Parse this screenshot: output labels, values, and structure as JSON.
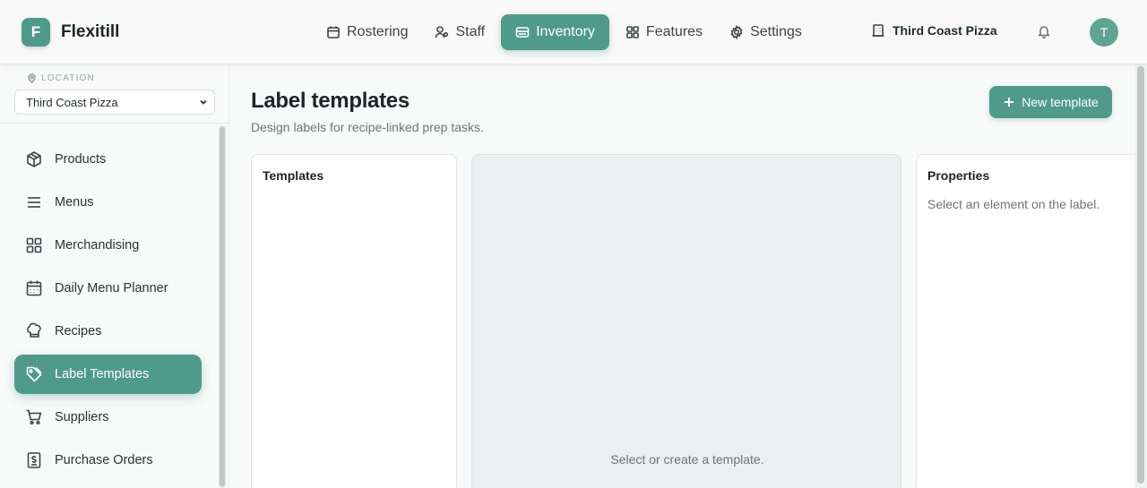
{
  "app": {
    "logo_letter": "F",
    "name": "Flexitill"
  },
  "nav": [
    {
      "label": "Rostering",
      "icon": "calendar-icon"
    },
    {
      "label": "Staff",
      "icon": "staff-icon"
    },
    {
      "label": "Inventory",
      "icon": "inventory-icon",
      "active": true
    },
    {
      "label": "Features",
      "icon": "grid-icon"
    },
    {
      "label": "Settings",
      "icon": "gear-icon"
    }
  ],
  "header": {
    "store_name": "Third Coast Pizza",
    "avatar_initial": "T"
  },
  "sidebar": {
    "location_label": "LOCATION",
    "location_value": "Third Coast Pizza",
    "items": [
      {
        "label": "Products",
        "icon": "box-icon"
      },
      {
        "label": "Menus",
        "icon": "menu-lines-icon"
      },
      {
        "label": "Merchandising",
        "icon": "grid-icon"
      },
      {
        "label": "Daily Menu Planner",
        "icon": "calendar-icon"
      },
      {
        "label": "Recipes",
        "icon": "chef-hat-icon"
      },
      {
        "label": "Label Templates",
        "icon": "tag-icon",
        "active": true
      },
      {
        "label": "Suppliers",
        "icon": "cart-icon"
      },
      {
        "label": "Purchase Orders",
        "icon": "receipt-icon"
      }
    ]
  },
  "main": {
    "title": "Label templates",
    "subtitle": "Design labels for recipe-linked prep tasks.",
    "new_button": "New template",
    "templates_panel": {
      "title": "Templates"
    },
    "canvas_panel": {
      "empty_text": "Select or create a template."
    },
    "properties_panel": {
      "title": "Properties",
      "hint": "Select an element on the label."
    }
  },
  "colors": {
    "accent": "#4f9a8b",
    "canvas_bg": "#ebeff1"
  }
}
